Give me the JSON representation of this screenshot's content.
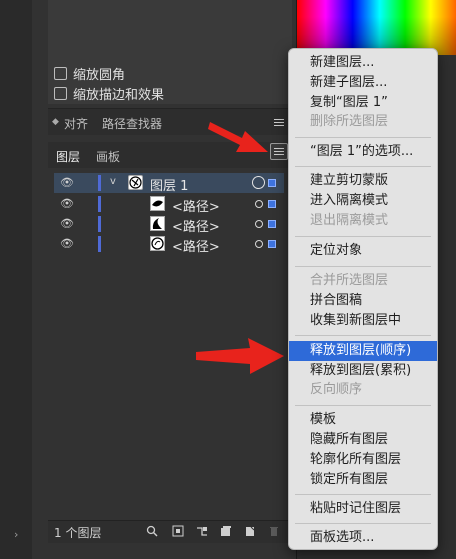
{
  "options": {
    "scale_corners": "缩放圆角",
    "scale_strokes": "缩放描边和效果"
  },
  "tabs_top": [
    "对齐",
    "路径查找器"
  ],
  "tabs_layers": [
    "图层",
    "画板"
  ],
  "layers": {
    "main_layer": "图层 1",
    "paths": [
      "<路径>",
      "<路径>",
      "<路径>"
    ]
  },
  "footer": {
    "count": "1 个图层"
  },
  "context_menu": {
    "group1": [
      "新建图层...",
      "新建子图层...",
      "复制“图层 1”",
      "删除所选图层"
    ],
    "group2": [
      "“图层 1”的选项..."
    ],
    "group3": [
      "建立剪切蒙版",
      "进入隔离模式",
      "退出隔离模式"
    ],
    "group4": [
      "定位对象"
    ],
    "group5": [
      "合并所选图层",
      "拼合图稿",
      "收集到新图层中"
    ],
    "group6": [
      "释放到图层(顺序)",
      "释放到图层(累积)",
      "反向顺序"
    ],
    "group7": [
      "模板",
      "隐藏所有图层",
      "轮廓化所有图层",
      "锁定所有图层"
    ],
    "group8": [
      "粘贴时记住图层"
    ],
    "group9": [
      "面板选项..."
    ]
  },
  "colors": {
    "highlight": "#2e6ad8",
    "arrow": "#e8231c",
    "layer_color": "#4f6ad6"
  }
}
